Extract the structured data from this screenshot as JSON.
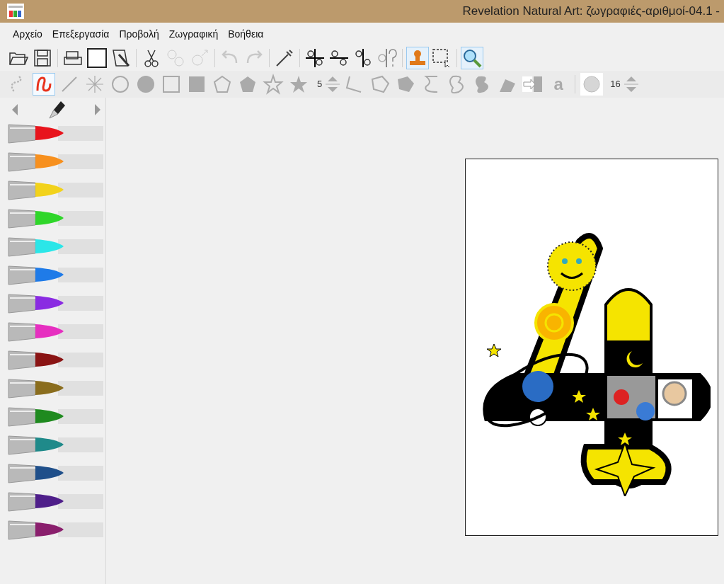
{
  "window": {
    "title": "Revelation Natural Art: ζωγραφιές-αριθμοί-04.1 -"
  },
  "menu": [
    "Αρχείο",
    "Επεξεργασία",
    "Προβολή",
    "Ζωγραφική",
    "Βοήθεια"
  ],
  "tools": [
    {
      "selected": false,
      "disabled": false
    },
    {
      "selected": false,
      "disabled": false
    },
    {
      "selected": false,
      "disabled": false
    },
    {
      "selected": false,
      "disabled": false
    },
    {
      "selected": false,
      "disabled": false
    },
    {
      "selected": false,
      "disabled": false
    },
    {
      "selected": false,
      "disabled": true
    },
    {
      "selected": false,
      "disabled": true
    },
    {
      "selected": false,
      "disabled": true
    },
    {
      "selected": false,
      "disabled": true
    },
    {
      "selected": false,
      "disabled": false
    },
    {
      "selected": false,
      "disabled": false
    },
    {
      "selected": false,
      "disabled": false
    },
    {
      "selected": false,
      "disabled": false
    },
    {
      "selected": false,
      "disabled": false
    },
    {
      "selected": true,
      "disabled": false
    },
    {
      "selected": false,
      "disabled": false
    },
    {
      "selected": true,
      "disabled": false
    }
  ],
  "shapes": [
    {
      "selected": false
    },
    {
      "selected": true
    },
    {
      "selected": false
    },
    {
      "selected": false
    },
    {
      "selected": false
    },
    {
      "selected": false
    },
    {
      "selected": false
    },
    {
      "selected": false
    },
    {
      "selected": false
    },
    {
      "selected": false
    },
    {
      "selected": false
    },
    {
      "selected": false
    }
  ],
  "star_points": "5",
  "shapes2": [
    {
      "selected": false
    },
    {
      "selected": false
    },
    {
      "selected": false
    },
    {
      "selected": false
    },
    {
      "selected": false
    },
    {
      "selected": false
    },
    {
      "selected": false
    },
    {
      "selected": false
    }
  ],
  "text_tool": "a",
  "brush_size": "16",
  "pens": [
    {
      "color": "#e8141c"
    },
    {
      "color": "#f7901e"
    },
    {
      "color": "#f2d21b"
    },
    {
      "color": "#2fd62a"
    },
    {
      "color": "#2be6e8"
    },
    {
      "color": "#1f7be8"
    },
    {
      "color": "#8a2be2"
    },
    {
      "color": "#e62fc0"
    },
    {
      "color": "#8a1414"
    },
    {
      "color": "#8a6d1e"
    },
    {
      "color": "#1f8a1f"
    },
    {
      "color": "#1f8a8a"
    },
    {
      "color": "#1f4f8a"
    },
    {
      "color": "#4f1f8a"
    },
    {
      "color": "#8a1f6d"
    }
  ]
}
